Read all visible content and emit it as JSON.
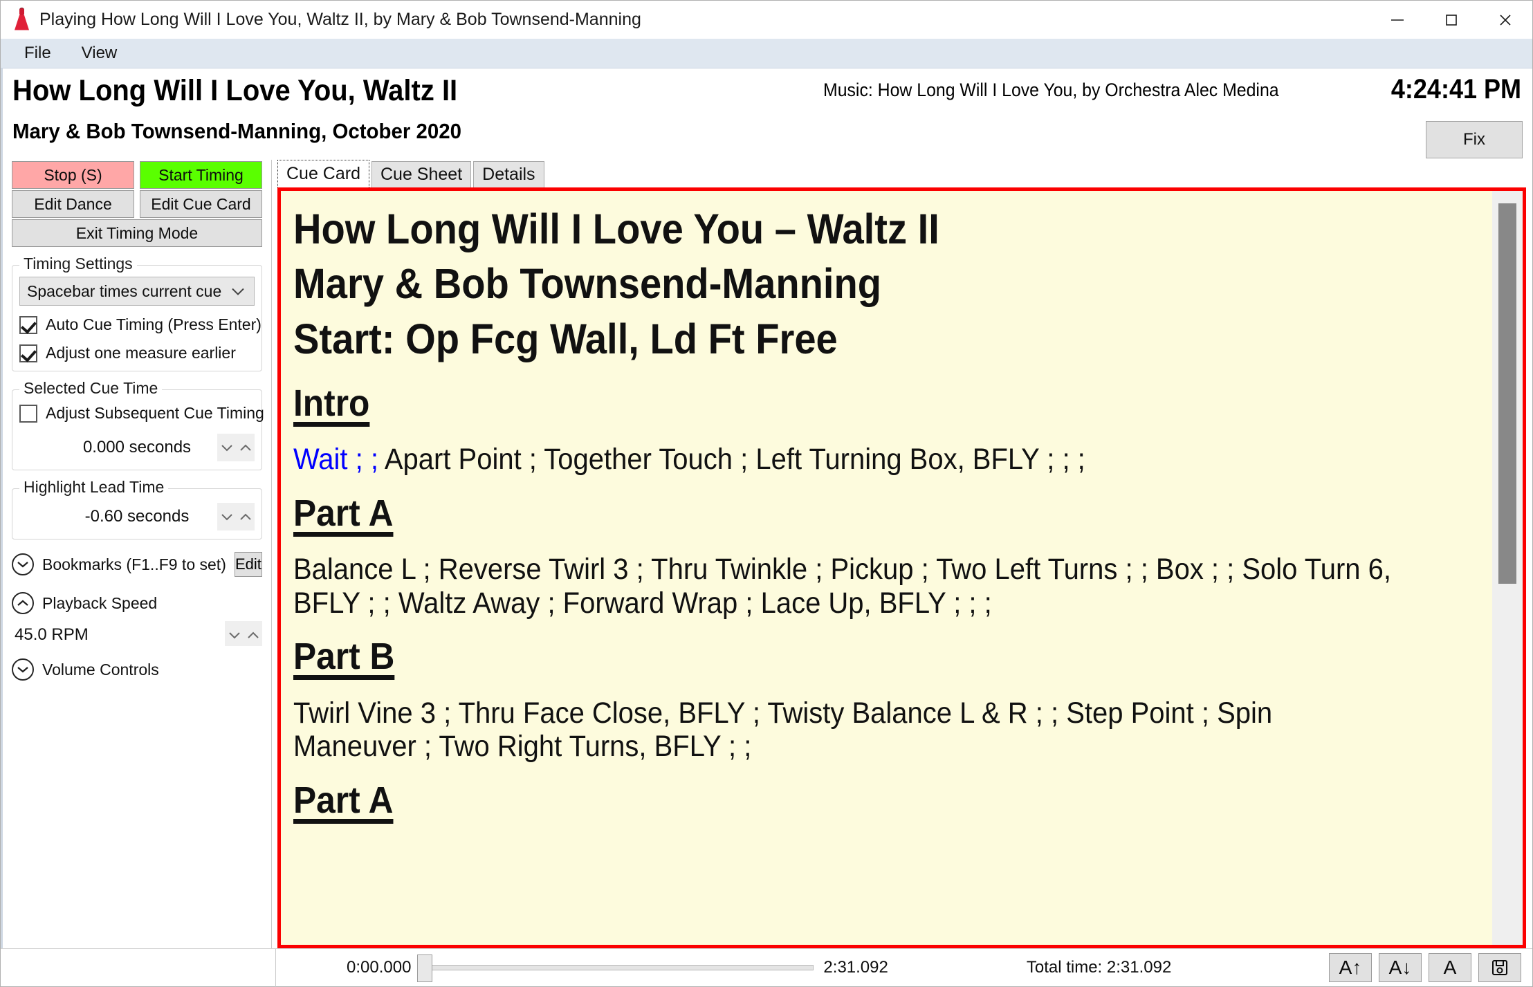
{
  "window": {
    "title": "Playing How Long Will I Love You, Waltz II, by Mary & Bob Townsend-Manning",
    "icon": "dancer-dress-icon",
    "minimize": "minimize-icon",
    "maximize": "maximize-icon",
    "close": "close-icon"
  },
  "menubar": {
    "items": [
      {
        "label": "File"
      },
      {
        "label": "View"
      }
    ]
  },
  "header": {
    "dance_title": "How Long Will I Love You, Waltz II",
    "dance_subtitle": "Mary & Bob Townsend-Manning, October 2020",
    "music_line": "Music: How Long Will I Love You, by Orchestra Alec Medina",
    "clock": "4:24:41 PM",
    "fix_button": "Fix"
  },
  "sidebar": {
    "stop_button": "Stop (S)",
    "start_timing_button": "Start Timing",
    "edit_dance_button": "Edit Dance",
    "edit_cue_card_button": "Edit Cue Card",
    "exit_timing_mode_button": "Exit Timing Mode",
    "timing_settings": {
      "group_title": "Timing Settings",
      "combo_value": "Spacebar times current cue",
      "checkboxes": [
        {
          "label": "Auto Cue Timing (Press Enter)",
          "checked": true
        },
        {
          "label": "Adjust one measure earlier",
          "checked": true
        }
      ]
    },
    "selected_cue_time": {
      "group_title": "Selected Cue Time",
      "checkbox": {
        "label": "Adjust Subsequent Cue Timing",
        "checked": false
      },
      "value": "0.000 seconds"
    },
    "highlight_lead_time": {
      "group_title": "Highlight Lead Time",
      "value": "-0.60 seconds"
    },
    "bookmarks": {
      "label": "Bookmarks (F1..F9 to set)",
      "edit_button": "Edit",
      "state": "collapsed"
    },
    "playback_speed": {
      "label": "Playback Speed",
      "state": "expanded",
      "value": "45.0 RPM"
    },
    "volume_controls": {
      "label": "Volume Controls",
      "state": "collapsed"
    }
  },
  "main": {
    "tabs": [
      {
        "label": "Cue Card",
        "active": true
      },
      {
        "label": "Cue Sheet",
        "active": false
      },
      {
        "label": "Details",
        "active": false
      }
    ],
    "cue_card": {
      "heading_1": "How Long Will I Love You – Waltz II",
      "heading_2": "Mary & Bob Townsend-Manning",
      "heading_3": "Start: Op Fcg Wall, Ld Ft Free",
      "sections": [
        {
          "name": "Intro",
          "highlight": "Wait ; ;",
          "text": " Apart Point ; Together Touch ; Left Turning Box, BFLY ; ; ;"
        },
        {
          "name": "Part A",
          "highlight": "",
          "text": "Balance L ; Reverse Twirl 3 ; Thru Twinkle ; Pickup ; Two Left Turns ; ; Box ; ; Solo Turn 6, BFLY ; ; Waltz Away ; Forward Wrap ; Lace Up, BFLY ; ; ;"
        },
        {
          "name": "Part B",
          "highlight": "",
          "text": "Twirl Vine 3 ; Thru Face Close, BFLY ; Twisty Balance L & R ; ; Step Point ; Spin Maneuver ; Two Right Turns, BFLY ; ;"
        },
        {
          "name": "Part A",
          "highlight": "",
          "text": ""
        }
      ]
    }
  },
  "statusbar": {
    "current_time": "0:00.000",
    "end_time": "2:31.092",
    "total_time": "Total time: 2:31.092",
    "buttons": [
      {
        "name": "font-larger-button",
        "label": "A↑"
      },
      {
        "name": "font-smaller-button",
        "label": "A↓"
      },
      {
        "name": "font-reset-button",
        "label": "A"
      },
      {
        "name": "save-button",
        "label": ""
      }
    ]
  }
}
